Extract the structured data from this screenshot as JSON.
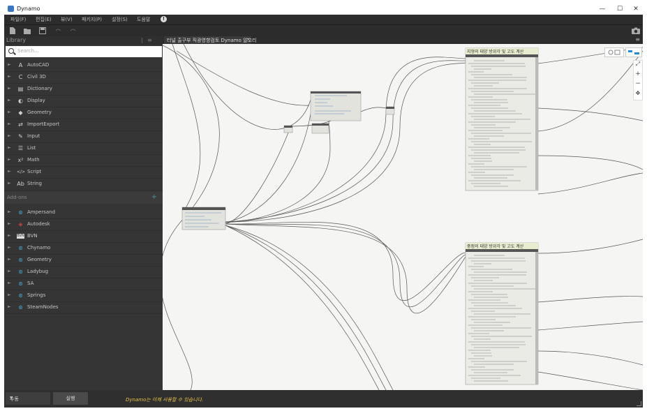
{
  "window": {
    "title": "Dynamo",
    "minimize": "—",
    "maximize": "☐",
    "close": "✕"
  },
  "menu": [
    "파일(F)",
    "편집(E)",
    "뷰(V)",
    "패키지(P)",
    "설정(S)",
    "도움말"
  ],
  "library": {
    "title": "Library",
    "search_placeholder": "Search...",
    "categories": [
      {
        "label": "AutoCAD",
        "icon": "A"
      },
      {
        "label": "Civil 3D",
        "icon": "C"
      },
      {
        "label": "Dictionary",
        "icon": "▤"
      },
      {
        "label": "Display",
        "icon": "◐"
      },
      {
        "label": "Geometry",
        "icon": "◆"
      },
      {
        "label": "ImportExport",
        "icon": "⇄"
      },
      {
        "label": "Input",
        "icon": "✎"
      },
      {
        "label": "List",
        "icon": "☰"
      },
      {
        "label": "Math",
        "icon": "x²"
      },
      {
        "label": "Script",
        "icon": "</>"
      },
      {
        "label": "String",
        "icon": "Ab"
      }
    ],
    "addons_label": "Add-ons",
    "addons_add": "+",
    "addons": [
      "Ampersand",
      "Autodesk",
      "BVN",
      "Chynamo",
      "Geometry",
      "Ladybug",
      "SA",
      "Springs",
      "SteamNodes"
    ]
  },
  "tab": {
    "label": "터널 출구부 직광영향검토 Dynamo 알고리",
    "close": "✕"
  },
  "nodes": {
    "top_title": "지형의 태양 방위각 및 고도 계산",
    "bottom_title": "중점의 태양 방위각 및 고도 계산"
  },
  "bottom": {
    "run_mode": "수동",
    "run_label": "실행",
    "status": "Dynamo는 이제 사용할 수 있습니다."
  },
  "colors": {
    "chrome": "#2c2c2c",
    "sidebar": "#353535",
    "node_header": "#e8edd0",
    "canvas": "#f5f5f4",
    "status": "#e6c24a"
  }
}
